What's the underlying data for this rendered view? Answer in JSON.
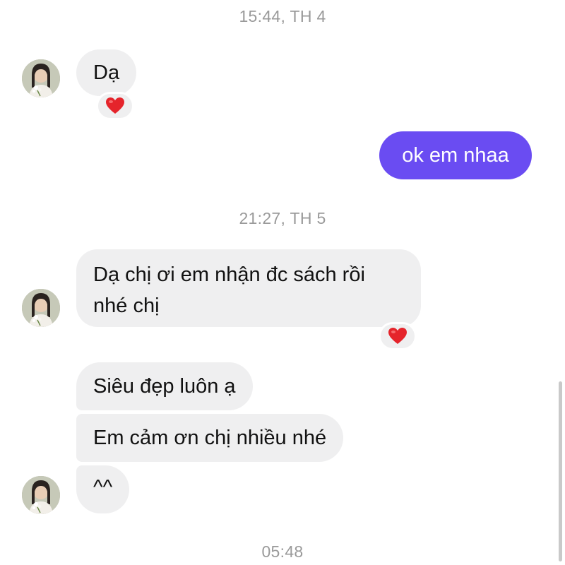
{
  "timestamps": {
    "t1": "15:44, TH 4",
    "t2": "21:27, TH 5",
    "t3": "05:48"
  },
  "messages": {
    "m1": "Dạ",
    "m2": "ok em nhaa",
    "m3_line1": "Dạ chị ơi em nhận đc sách rồi",
    "m3_line2": "nhé chị",
    "m4": "Siêu đẹp luôn ạ",
    "m5": "Em cảm ơn chị nhiều nhé",
    "m6": "^^"
  },
  "reactions": {
    "r1": "heart-icon",
    "r2": "heart-icon"
  },
  "colors": {
    "outgoing_bubble": "#6a4cf2",
    "incoming_bubble": "#efeff0",
    "timestamp_text": "#9a9a9a",
    "heart": "#e5242b"
  }
}
